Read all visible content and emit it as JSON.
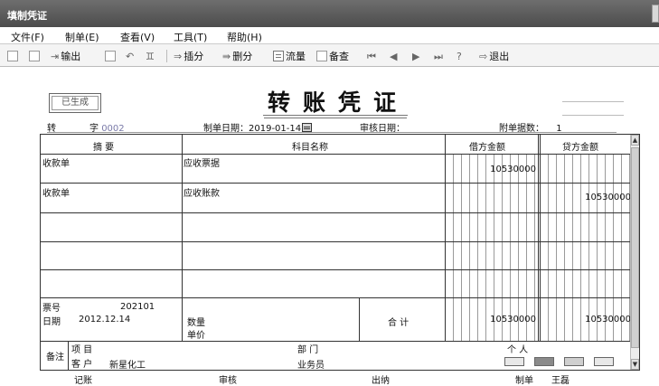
{
  "window": {
    "title": "填制凭证"
  },
  "menu": [
    {
      "label": "文件(F)"
    },
    {
      "label": "制单(E)"
    },
    {
      "label": "查看(V)"
    },
    {
      "label": "工具(T)"
    },
    {
      "label": "帮助(H)"
    }
  ],
  "toolbar": {
    "export": "输出",
    "insert": "插分",
    "delete": "删分",
    "cashflow": "流量",
    "reference": "备查",
    "exit": "退出"
  },
  "voucher": {
    "status_badge": "已生成",
    "title": "转账凭证",
    "type_label": "转",
    "number_label": "字",
    "number_value": "0002",
    "date_label": "制单日期：",
    "date_value": "2019-01-14",
    "audit_date_label": "审核日期：",
    "attachments_label": "附单据数：",
    "attachments_value": "1"
  },
  "table": {
    "headers": {
      "summary": "摘  要",
      "account": "科目名称",
      "debit": "借方金额",
      "credit": "贷方金额"
    },
    "rows": [
      {
        "summary": "收款单",
        "account": "应收票据",
        "debit": "10530000",
        "credit": ""
      },
      {
        "summary": "收款单",
        "account": "应收账款",
        "debit": "",
        "credit": "10530000"
      },
      {
        "summary": "",
        "account": "",
        "debit": "",
        "credit": ""
      },
      {
        "summary": "",
        "account": "",
        "debit": "",
        "credit": ""
      },
      {
        "summary": "",
        "account": "",
        "debit": "",
        "credit": ""
      }
    ],
    "ticket_no_label": "票号",
    "ticket_no_value": "202101",
    "date_label": "日期",
    "date_value": "2012.12.14",
    "quantity_label": "数量",
    "unit_price_label": "单价",
    "total_label": "合  计",
    "total_debit": "10530000",
    "total_credit": "10530000"
  },
  "remarks": {
    "label": "备注",
    "project_label": "项  目",
    "department_label": "部  门",
    "person_label": "个  人",
    "customer_label": "客  户",
    "customer_value": "新星化工",
    "salesperson_label": "业务员"
  },
  "footer": {
    "bookkeeper_label": "记账",
    "auditor_label": "审核",
    "cashier_label": "出纳",
    "maker_label": "制单",
    "maker_value": "王磊"
  }
}
